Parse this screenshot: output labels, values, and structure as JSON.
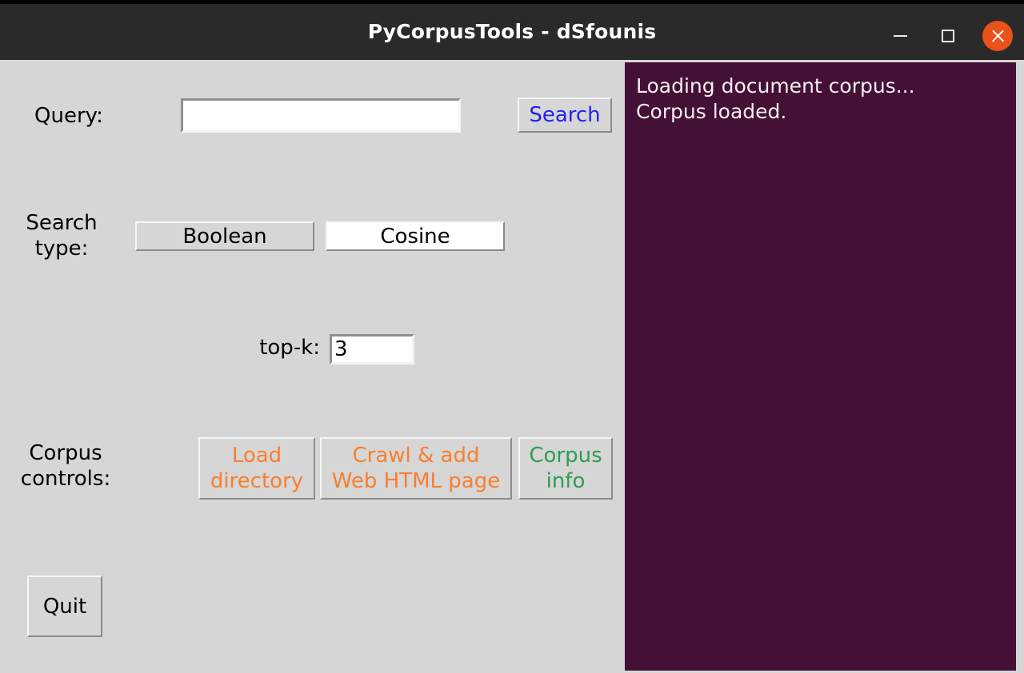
{
  "window": {
    "title": "PyCorpusTools - dSfounis",
    "controls": {
      "minimize_label": "Minimize",
      "maximize_label": "Maximize",
      "close_label": "Close"
    },
    "colors": {
      "titlebar_bg": "#2b2a2a",
      "client_bg": "#d6d6d6",
      "close_button_bg": "#e9521b",
      "log_pane_bg": "#451036",
      "accent_blue": "#2222ee",
      "accent_orange": "#f97f2e",
      "accent_green": "#2e9e50"
    }
  },
  "form": {
    "query": {
      "label": "Query:",
      "value": "",
      "placeholder": "",
      "search_button_label": "Search"
    },
    "search_type": {
      "label": "Search\ntype:",
      "label_line1": "Search",
      "label_line2": "type:",
      "selected": "Cosine",
      "options": [
        {
          "label": "Boolean",
          "selected": false
        },
        {
          "label": "Cosine",
          "selected": true
        }
      ]
    },
    "top_k": {
      "label": "top-k:",
      "value": "3"
    },
    "corpus_controls": {
      "label_line1": "Corpus",
      "label_line2": "controls:",
      "buttons": [
        {
          "label_line1": "Load",
          "label_line2": "directory",
          "color": "orange"
        },
        {
          "label_line1": "Crawl & add",
          "label_line2": "Web HTML page",
          "color": "orange"
        },
        {
          "label_line1": "Corpus",
          "label_line2": "info",
          "color": "green"
        }
      ]
    },
    "quit_button_label": "Quit"
  },
  "log": {
    "lines": [
      "Loading document corpus...",
      "Corpus loaded."
    ],
    "text": "Loading document corpus...\nCorpus loaded."
  }
}
